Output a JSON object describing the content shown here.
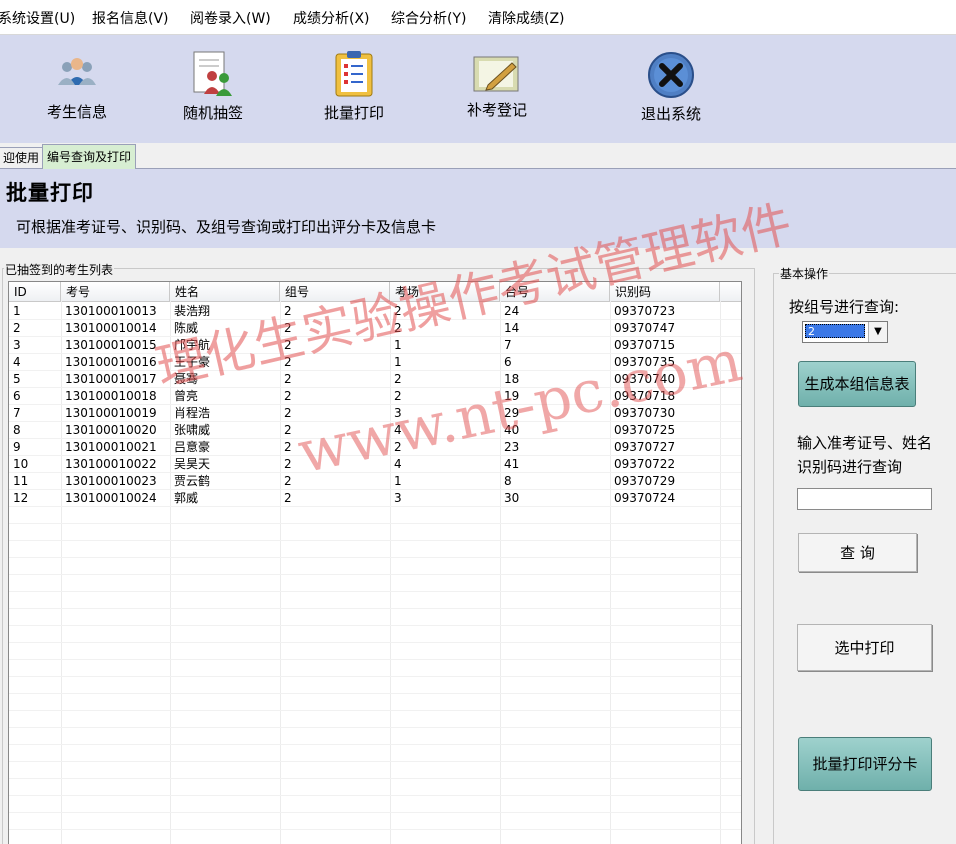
{
  "menu": [
    "系统设置(U)",
    "报名信息(V)",
    "阅卷录入(W)",
    "成绩分析(X)",
    "综合分析(Y)",
    "清除成绩(Z)"
  ],
  "toolbar": [
    {
      "label": "考生信息",
      "icon": "users-group-icon"
    },
    {
      "label": "随机抽签",
      "icon": "people-draw-icon"
    },
    {
      "label": "批量打印",
      "icon": "clipboard-list-icon"
    },
    {
      "label": "补考登记",
      "icon": "edit-note-icon"
    },
    {
      "label": "退出系统",
      "icon": "close-circle-icon"
    }
  ],
  "tabs": [
    {
      "label": "迎使用"
    },
    {
      "label": "编号查询及打印",
      "active": true
    }
  ],
  "header": {
    "title": "批量打印",
    "description": "可根据准考证号、识别码、及组号查询或打印出评分卡及信息卡"
  },
  "list": {
    "group_title": "已抽签到的考生列表",
    "columns": [
      "ID",
      "考号",
      "姓名",
      "组号",
      "考场",
      "台号",
      "识别码"
    ],
    "rows": [
      [
        "1",
        "130100010013",
        "裴浩翔",
        "2",
        "2",
        "24",
        "09370723"
      ],
      [
        "2",
        "130100010014",
        "陈威",
        "2",
        "2",
        "14",
        "09370747"
      ],
      [
        "3",
        "130100010015",
        "邝宇航",
        "2",
        "1",
        "7",
        "09370715"
      ],
      [
        "4",
        "130100010016",
        "王子豪",
        "2",
        "1",
        "6",
        "09370735"
      ],
      [
        "5",
        "130100010017",
        "聂骞",
        "2",
        "2",
        "18",
        "09370740"
      ],
      [
        "6",
        "130100010018",
        "曾亮",
        "2",
        "2",
        "19",
        "09370718"
      ],
      [
        "7",
        "130100010019",
        "肖程浩",
        "2",
        "3",
        "29",
        "09370730"
      ],
      [
        "8",
        "130100010020",
        "张啸威",
        "2",
        "4",
        "40",
        "09370725"
      ],
      [
        "9",
        "130100010021",
        "吕意豪",
        "2",
        "2",
        "23",
        "09370727"
      ],
      [
        "10",
        "130100010022",
        "吴昊天",
        "2",
        "4",
        "41",
        "09370722"
      ],
      [
        "11",
        "130100010023",
        "贾云鹤",
        "2",
        "1",
        "8",
        "09370729"
      ],
      [
        "12",
        "130100010024",
        "郭威",
        "2",
        "3",
        "30",
        "09370724"
      ]
    ]
  },
  "panel": {
    "group_title": "基本操作",
    "group_query_label": "按组号进行查询:",
    "group_value": "2",
    "gen_button": "生成本组信息表",
    "search_label_1": "输入准考证号、姓名",
    "search_label_2": "识别码进行查询",
    "search_value": "",
    "query_button": "查 询",
    "print_selected_button": "选中打印",
    "batch_print_button": "批量打印评分卡"
  },
  "watermark": {
    "line1": "理化生实验操作考试管理软件",
    "line2": "www.nt-pc.com"
  }
}
